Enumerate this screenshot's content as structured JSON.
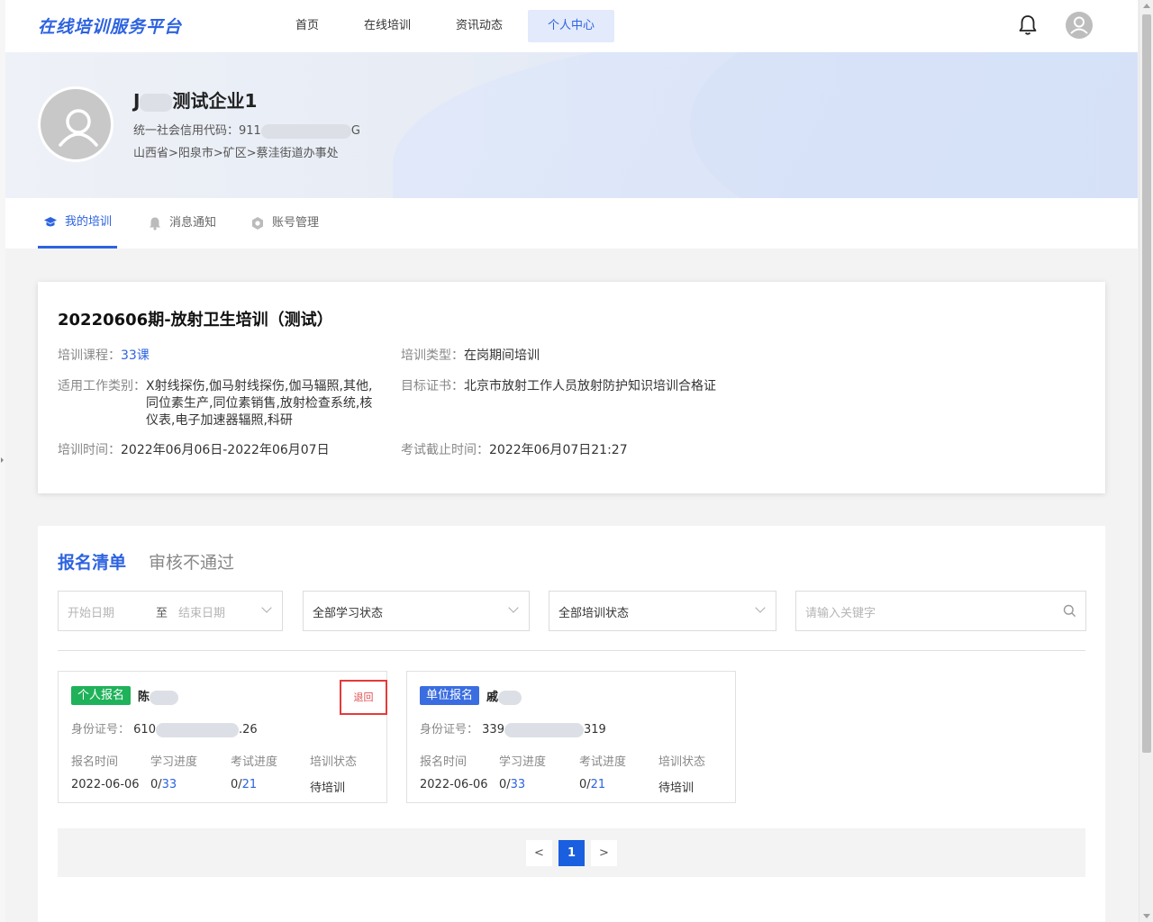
{
  "app": {
    "logo": "在线培训服务平台"
  },
  "nav": {
    "items": [
      {
        "label": "首页",
        "active": false
      },
      {
        "label": "在线培训",
        "active": false
      },
      {
        "label": "资讯动态",
        "active": false
      },
      {
        "label": "个人中心",
        "active": true
      }
    ],
    "bell_icon": "bell-icon",
    "user_icon": "user-avatar-icon"
  },
  "profile": {
    "company_name_visible": "测试企业1",
    "company_name_prefix_visible": "J",
    "credit_label": "统一社会信用代码：",
    "credit_code_start": "911",
    "credit_code_end": "G",
    "region": "山西省>阳泉市>矿区>蔡洼街道办事处"
  },
  "tabs": [
    {
      "label": "我的培训",
      "icon": "graduation-cap-icon",
      "active": true
    },
    {
      "label": "消息通知",
      "icon": "bell-icon",
      "active": false
    },
    {
      "label": "账号管理",
      "icon": "settings-icon",
      "active": false
    }
  ],
  "training": {
    "title": "20220606期-放射卫生培训（测试）",
    "course_label": "培训课程：",
    "course_value": "33课",
    "type_label": "培训类型：",
    "type_value": "在岗期间培训",
    "category_label": "适用工作类别：",
    "category_value": "X射线探伤,伽马射线探伤,伽马辐照,其他,同位素生产,同位素销售,放射检查系统,核仪表,电子加速器辐照,科研",
    "cert_label": "目标证书：",
    "cert_value": "北京市放射工作人员放射防护知识培训合格证",
    "time_label": "培训时间：",
    "time_value": "2022年06月06日-2022年06月07日",
    "deadline_label": "考试截止时间：",
    "deadline_value": "2022年06月07日21:27"
  },
  "list": {
    "tab_active": "报名清单",
    "tab_other": "审核不通过",
    "filters": {
      "start_placeholder": "开始日期",
      "range_sep": "至",
      "end_placeholder": "结束日期",
      "study_status": "全部学习状态",
      "train_status": "全部培训状态",
      "keyword_placeholder": "请输入关键字"
    },
    "cards": [
      {
        "badge": "个人报名",
        "badge_color": "#1fb25a",
        "name_visible": "陈",
        "action": "退回",
        "id_label": "身份证号：",
        "id_start": "610",
        "id_end": "26",
        "cols": [
          {
            "header": "报名时间",
            "value": "2022-06-06"
          },
          {
            "header": "学习进度",
            "done": "0/",
            "total": "33"
          },
          {
            "header": "考试进度",
            "done": "0/",
            "total": "21"
          },
          {
            "header": "培训状态",
            "value": "待培训"
          }
        ]
      },
      {
        "badge": "单位报名",
        "badge_color": "#3a6de0",
        "name_visible": "戚",
        "id_label": "身份证号：",
        "id_start": "339",
        "id_end": "319",
        "cols": [
          {
            "header": "报名时间",
            "value": "2022-06-06"
          },
          {
            "header": "学习进度",
            "done": "0/",
            "total": "33"
          },
          {
            "header": "考试进度",
            "done": "0/",
            "total": "21"
          },
          {
            "header": "培训状态",
            "value": "待培训"
          }
        ]
      }
    ],
    "pager": {
      "prev": "<",
      "current": "1",
      "next": ">"
    }
  },
  "colors": {
    "accent": "#2d63e0",
    "green": "#1fb25a",
    "alert": "#e53a3a"
  }
}
